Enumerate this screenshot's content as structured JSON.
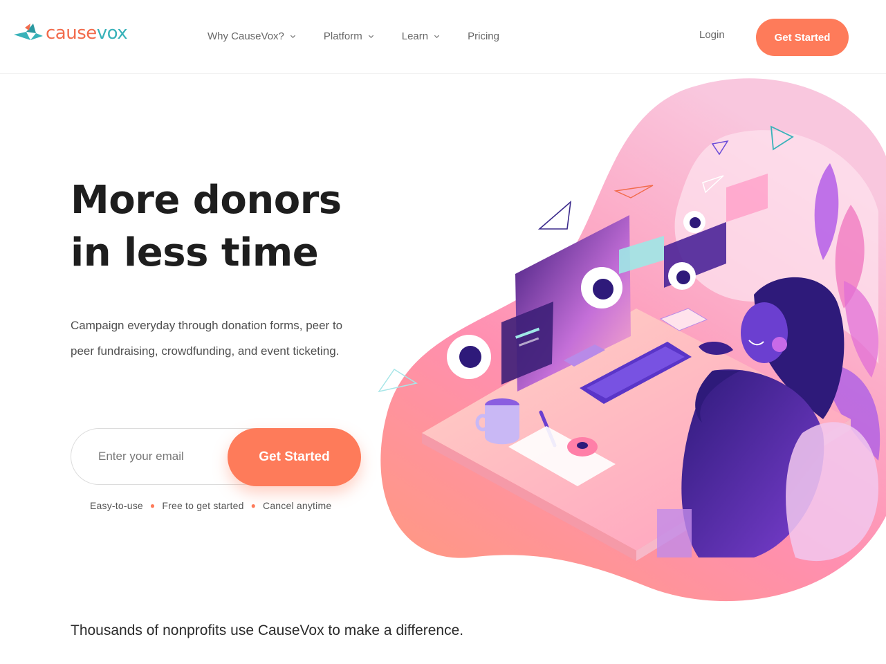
{
  "header": {
    "logo": {
      "part1": "cause",
      "part2": "vox"
    },
    "nav": [
      {
        "label": "Why CauseVox?",
        "has_dropdown": true
      },
      {
        "label": "Platform",
        "has_dropdown": true
      },
      {
        "label": "Learn",
        "has_dropdown": true
      },
      {
        "label": "Pricing",
        "has_dropdown": false
      }
    ],
    "login": "Login",
    "cta": "Get Started"
  },
  "hero": {
    "title_line1": "More donors",
    "title_line2": "in less time",
    "subtitle": "Campaign everyday through donation forms, peer to peer fundraising, crowdfunding, and event ticketing.",
    "email": {
      "placeholder": "Enter your email",
      "value": ""
    },
    "cta": "Get Started",
    "features": [
      "Easy-to-use",
      "Free to get started",
      "Cancel anytime"
    ]
  },
  "social_proof": "Thousands of nonprofits use CauseVox to make a difference.",
  "colors": {
    "accent": "#fe7b5a",
    "teal": "#38b2b9",
    "logo_orange": "#f26b4c",
    "illustration_purple": "#3b1f8c"
  }
}
